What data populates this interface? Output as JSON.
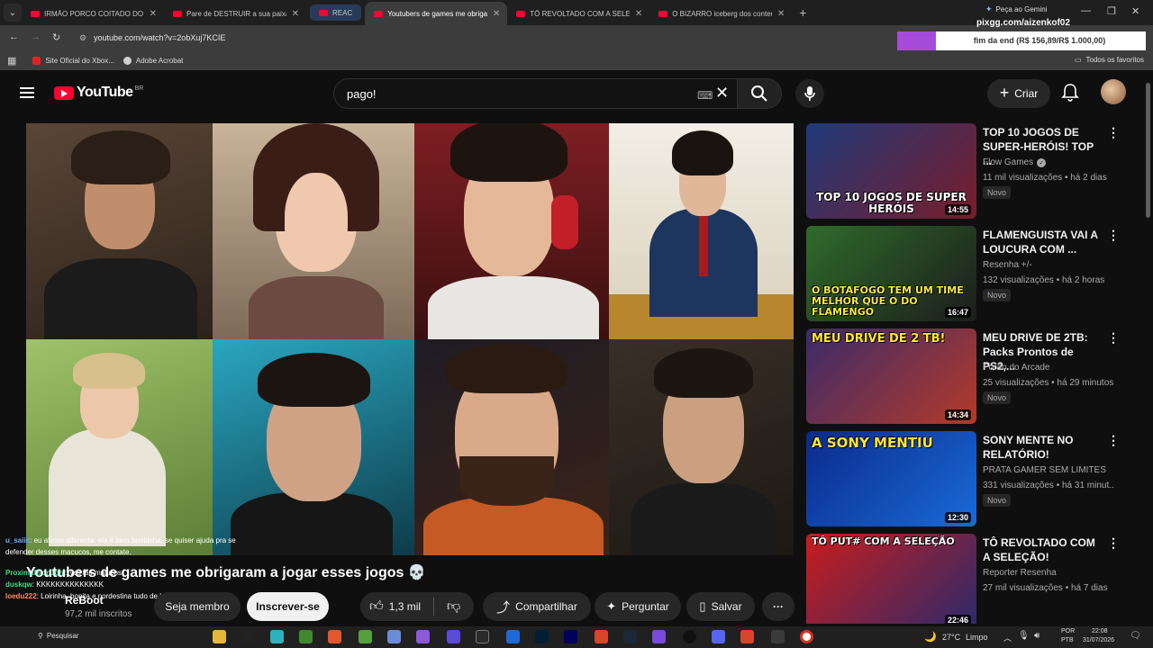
{
  "browser": {
    "tabs": [
      {
        "label": "IRMÃO PORCO COITADO DO G"
      },
      {
        "label": "Pare de DESTRUIR a sua paixão"
      },
      {
        "label": "REAC"
      },
      {
        "label": "Youtubers de games me obriga"
      },
      {
        "label": "TÔ REVOLTADO COM A SELEÇÃ"
      },
      {
        "label": "O BIZARRO iceberg dos conteú"
      }
    ],
    "gemini_label": "Peça ao Gemini",
    "pix_url": "pixgg.com/aizenkof02",
    "url": "youtube.com/watch?v=2obXuj7KCIE",
    "donation": {
      "text": "fim da end (R$ 156,89/R$ 1.000,00)",
      "progress": 0.1569
    },
    "bookmarks": [
      "Site Oficial do Xbox...",
      "Adobe Acrobat"
    ],
    "all_bookmarks": "Todos os favoritos"
  },
  "youtube": {
    "logo_text": "YouTube",
    "region": "BR",
    "search_query": "pago!",
    "create_label": "Criar"
  },
  "video": {
    "title": "Youtubers de games me obrigaram a jogar esses jogos 💀",
    "channel": "ReBoot",
    "subscribers": "97,2 mil inscritos",
    "join_label": "Seja membro",
    "subscribe_label": "Inscrever-se",
    "likes": "1,3 mil",
    "share_label": "Compartilhar",
    "ask_label": "Perguntar",
    "save_label": "Salvar"
  },
  "chat": [
    {
      "user": "u_saiic",
      "text": ": eu afirmo diferente: ela é bem bonitinha, se quiser ajuda pra se",
      "color": "#6ab0ff"
    },
    {
      "user": "",
      "text": "defender desses macucos, me contate.",
      "color": "#ffffff"
    },
    {
      "user": "ProximaMidn1ght",
      "text": ": vcs tão malucos",
      "color": "#3ddc84"
    },
    {
      "user": "duskqw",
      "text": ": KKKKKKKKKKKKKK",
      "color": "#3ddc84"
    },
    {
      "user": "loedu222",
      "text": ": Loirinha, bonita e nordestina tudo de bom",
      "color": "#ff8a65"
    }
  ],
  "recommendations": [
    {
      "title": "TOP 10 JOGOS DE SUPER-HERÓIS! TOP ...",
      "channel": "Flow Games",
      "verified": true,
      "meta": "11 mil visualizações • há 2 dias",
      "badge": "Novo",
      "duration": "14:55",
      "thumb_text": "TOP 10 JOGOS DE SUPER HERÓIS"
    },
    {
      "title": "FLAMENGUISTA VAI A LOUCURA COM ...",
      "channel": "Resenha +/-",
      "verified": false,
      "meta": "132 visualizações • há 2 horas",
      "badge": "Novo",
      "duration": "16:47",
      "thumb_text": "O BOTAFOGO TEM UM TIME MELHOR QUE O DO FLAMENGO"
    },
    {
      "title": "MEU DRIVE DE 2TB: Packs Prontos de PS2,...",
      "channel": "Porão do Arcade",
      "verified": false,
      "meta": "25 visualizações • há 29 minutos",
      "badge": "Novo",
      "duration": "14:34",
      "thumb_text": "MEU DRIVE DE 2 TB!"
    },
    {
      "title": "SONY MENTE NO RELATÓRIO!",
      "channel": "PRATA GAMER SEM LIMITES",
      "verified": false,
      "meta": "331 visualizações • há 31 minut...",
      "badge": "Novo",
      "duration": "12:30",
      "thumb_text": "A SONY MENTIU"
    },
    {
      "title": "TÔ REVOLTADO COM A SELEÇÃO!",
      "channel": "Reporter Resenha",
      "verified": false,
      "meta": "27 mil visualizações • há 7 dias",
      "badge": "",
      "duration": "22:46",
      "thumb_text": "TÔ PUT# COM A SELEÇÃO"
    }
  ],
  "taskbar": {
    "search_placeholder": "Pesquisar",
    "weather": "27°C",
    "weather_desc": "Limpo",
    "lang_top": "POR",
    "lang_bottom": "PTB",
    "time": "22:08",
    "date": "31/07/2026"
  }
}
